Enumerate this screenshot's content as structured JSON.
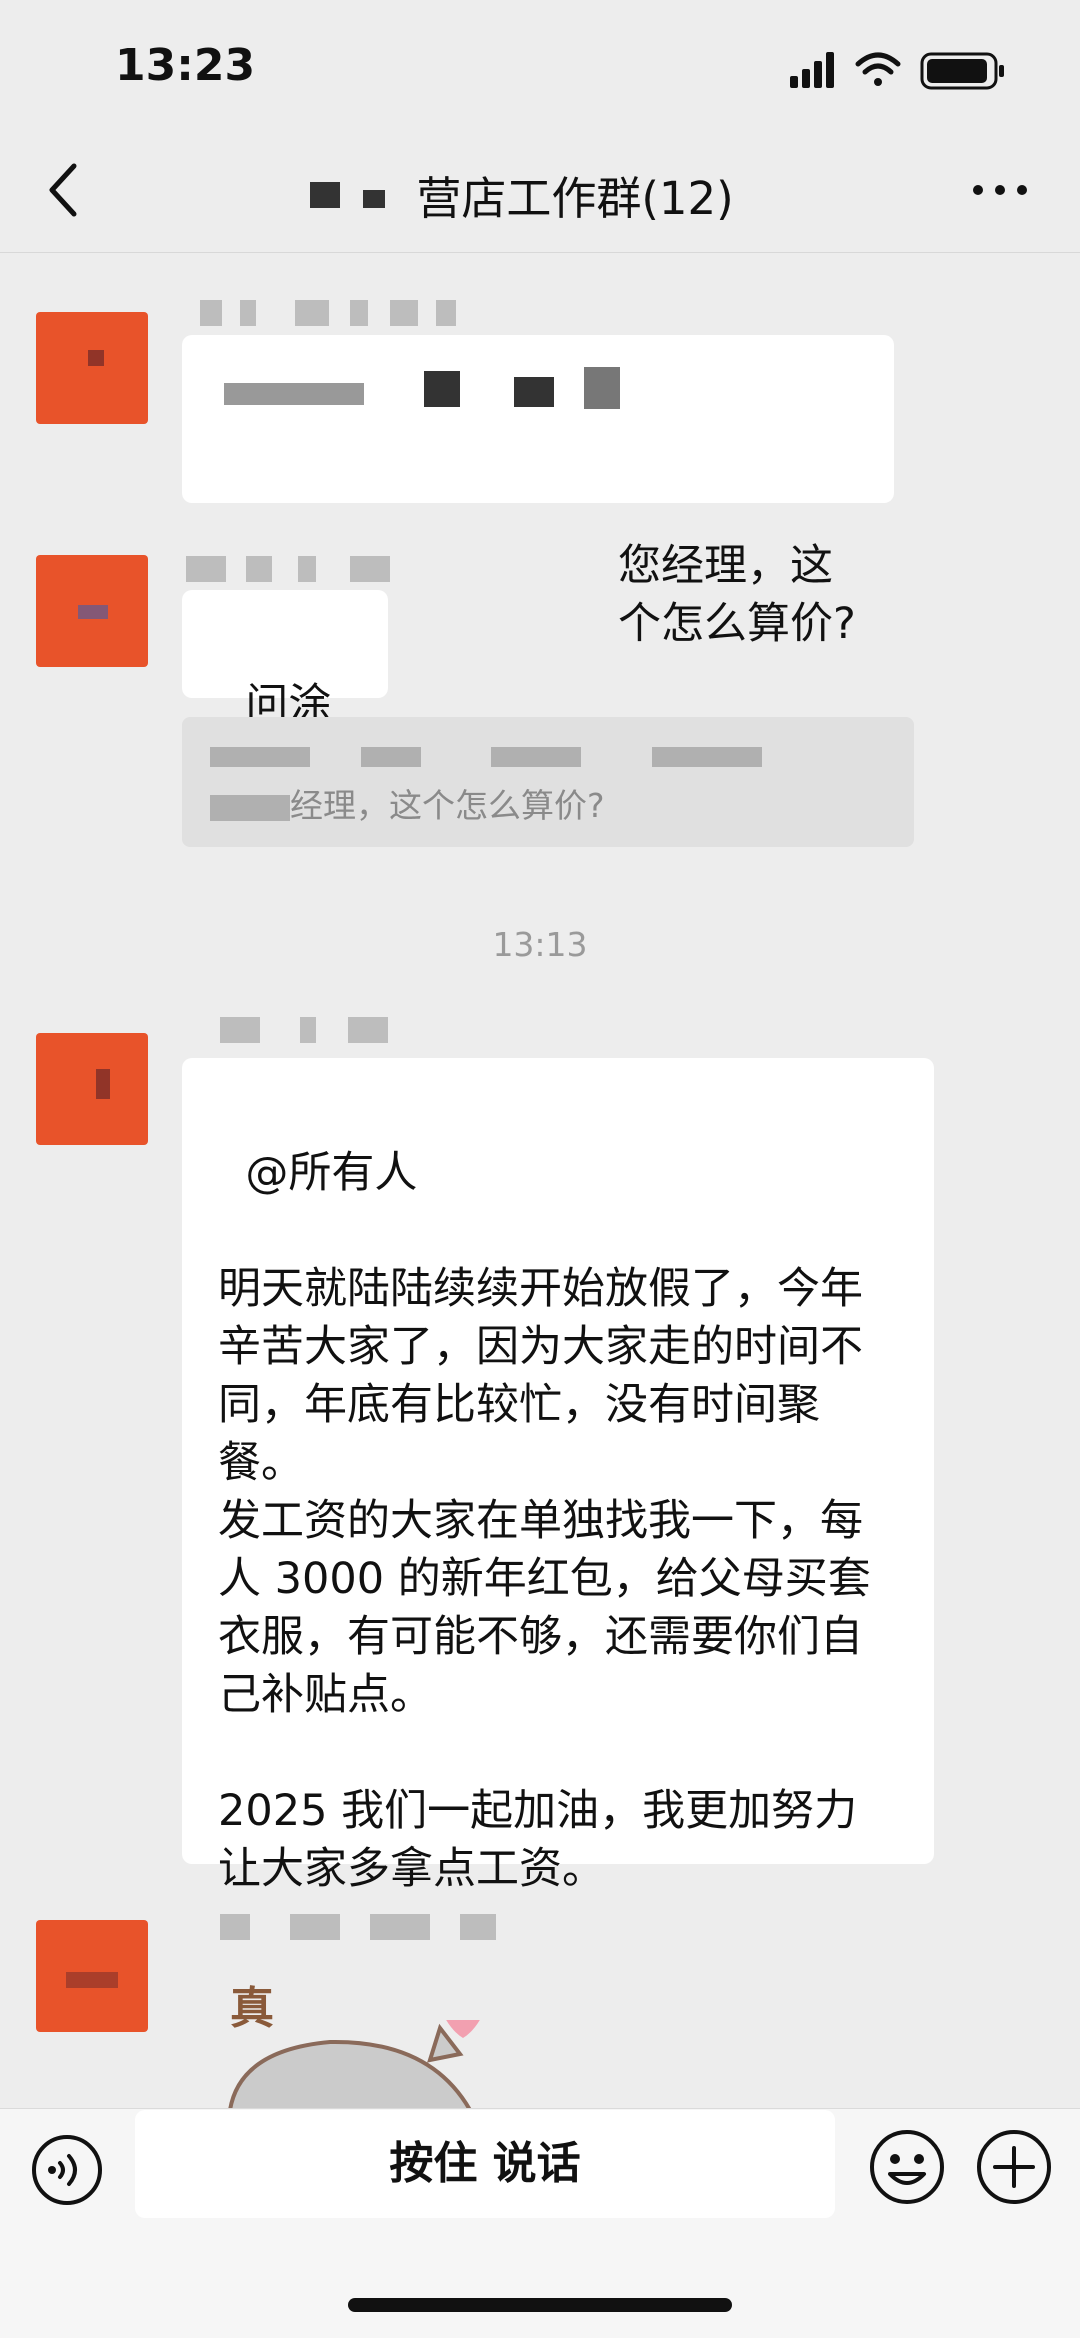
{
  "status_bar": {
    "time": "13:23"
  },
  "header": {
    "title": "营店工作群(12)"
  },
  "messages": {
    "m1_text": "您经理，这\n个怎么算价?",
    "m2_text": "问涂涂",
    "quote_text": "经理，这个怎么算价?",
    "timestamp": "13:13",
    "m3_text": "@所有人\n\n明天就陆陆续续开始放假了，今年辛苦大家了，因为大家走的时间不同，年底有比较忙，没有时间聚餐。\n发工资的大家在单独找我一下，每人 3000 的新年红包，给父母买套衣服，有可能不够，还需要你们自己补贴点。\n\n2025 我们一起加油，我更加努力让大家多拿点工资。",
    "sticker_text": "真"
  },
  "input_bar": {
    "hold_to_talk_label": "按住 说话"
  },
  "icons": {
    "back": "back-icon",
    "more": "more-icon",
    "voice": "voice-icon",
    "emoji": "emoji-icon",
    "plus": "plus-icon"
  },
  "colors": {
    "avatar": "#e8532a",
    "background": "#ededed",
    "bubble": "#ffffff"
  }
}
